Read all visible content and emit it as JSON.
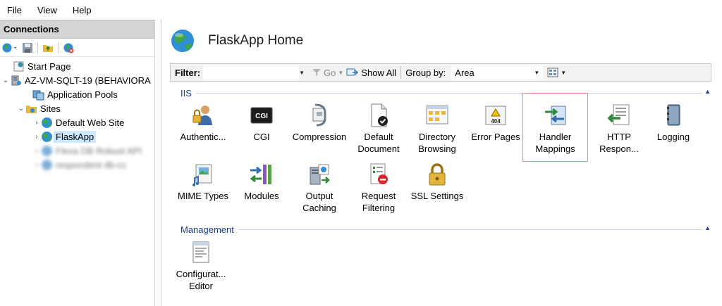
{
  "menu": [
    "File",
    "View",
    "Help"
  ],
  "connections": {
    "header": "Connections",
    "tree": [
      {
        "label": "Start Page"
      },
      {
        "label": "AZ-VM-SQLT-19 (BEHAVIORA"
      },
      {
        "label": "Application Pools"
      },
      {
        "label": "Sites"
      },
      {
        "label": "Default Web Site"
      },
      {
        "label": "FlaskApp"
      },
      {
        "label": "Flexa DB Robust API"
      },
      {
        "label": "respondent db-cc"
      }
    ]
  },
  "main": {
    "title": "FlaskApp Home",
    "filter": {
      "label": "Filter:",
      "value": "",
      "go_label": "Go",
      "show_all_label": "Show All",
      "group_by_label": "Group by:",
      "group_by_value": "Area"
    },
    "sections": [
      {
        "name": "IIS",
        "features": [
          {
            "label": "Authentic...",
            "icon": "authentication-icon"
          },
          {
            "label": "CGI",
            "icon": "cgi-icon"
          },
          {
            "label": "Compression",
            "icon": "compression-icon"
          },
          {
            "label": "Default Document",
            "icon": "default-document-icon"
          },
          {
            "label": "Directory Browsing",
            "icon": "directory-browsing-icon"
          },
          {
            "label": "Error Pages",
            "icon": "error-pages-icon"
          },
          {
            "label": "Handler Mappings",
            "icon": "handler-mappings-icon"
          },
          {
            "label": "HTTP Respon...",
            "icon": "http-response-icon"
          },
          {
            "label": "Logging",
            "icon": "logging-icon"
          },
          {
            "label": "MIME Types",
            "icon": "mime-types-icon"
          },
          {
            "label": "Modules",
            "icon": "modules-icon"
          },
          {
            "label": "Output Caching",
            "icon": "output-caching-icon"
          },
          {
            "label": "Request Filtering",
            "icon": "request-filtering-icon"
          },
          {
            "label": "SSL Settings",
            "icon": "ssl-lock-icon"
          }
        ]
      },
      {
        "name": "Management",
        "features": [
          {
            "label": "Configurat... Editor",
            "icon": "configuration-editor-icon"
          }
        ]
      }
    ]
  },
  "colors": {
    "section_header": "#1a3e8c",
    "selection": "#cce8ff",
    "highlight_border": "#e88888"
  }
}
